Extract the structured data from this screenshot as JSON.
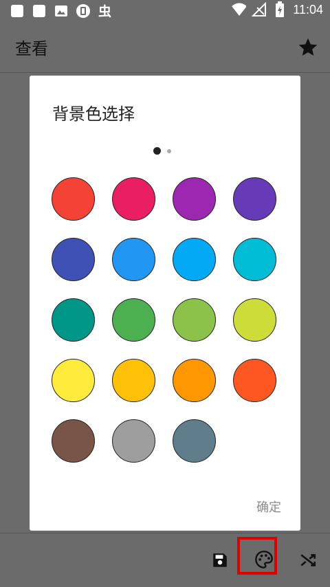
{
  "status_bar": {
    "time": "11:04",
    "left_icons": [
      "square-icon",
      "square-icon",
      "image-icon",
      "sim-icon",
      "bug-icon"
    ],
    "right_icons": [
      "wifi-icon",
      "no-signal-icon",
      "battery-charging-icon"
    ]
  },
  "app_bar": {
    "title": "查看",
    "action_icon": "star-icon"
  },
  "dialog": {
    "title": "背景色选择",
    "page_indicator": {
      "current": 1,
      "total": 2
    },
    "colors": [
      "#F44336",
      "#E91E63",
      "#9C27B0",
      "#673AB7",
      "#3F51B5",
      "#2196F3",
      "#03A9F4",
      "#00BCD4",
      "#009688",
      "#4CAF50",
      "#8BC34A",
      "#CDDC39",
      "#FFEB3B",
      "#FFC107",
      "#FF9800",
      "#FF5722",
      "#795548",
      "#9E9E9E",
      "#607D8B"
    ],
    "confirm_label": "确定"
  },
  "toolbar": {
    "buttons": [
      "save-icon",
      "palette-icon",
      "shuffle-icon"
    ],
    "highlighted": "palette-icon",
    "highlight_color": "#E00000"
  }
}
